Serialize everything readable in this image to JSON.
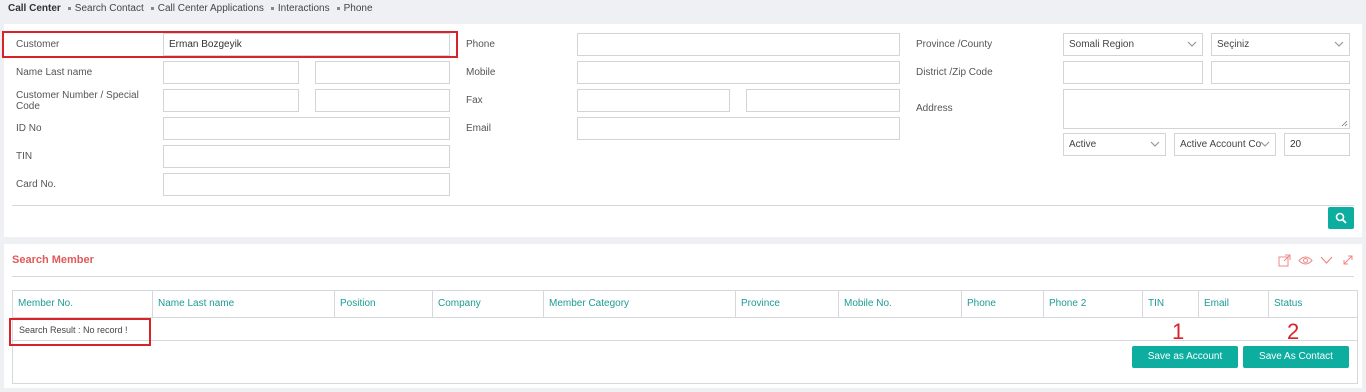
{
  "breadcrumb": {
    "home": "Call Center",
    "items": [
      "Search Contact",
      "Call Center Applications",
      "Interactions",
      "Phone"
    ]
  },
  "form": {
    "customer_label": "Customer",
    "customer_value": "Erman Bozgeyik",
    "name_label": "Name Last name",
    "custnum_label": "Customer Number / Special Code",
    "idno_label": "ID No",
    "tin_label": "TIN",
    "card_label": "Card No.",
    "phone_label": "Phone",
    "mobile_label": "Mobile",
    "fax_label": "Fax",
    "email_label": "Email",
    "province_label": "Province /County",
    "province_value": "Somali Region",
    "county_value": "Seçiniz",
    "district_label": "District /Zip Code",
    "address_label": "Address",
    "status_value": "Active",
    "account_value": "Active Account Co",
    "count_value": "20"
  },
  "search_member": {
    "title": "Search Member",
    "columns": [
      "Member No.",
      "Name Last name",
      "Position",
      "Company",
      "Member Category",
      "Province",
      "Mobile No.",
      "Phone",
      "Phone 2",
      "TIN",
      "Email",
      "Status"
    ],
    "result_text": "Search Result : No record !",
    "save_account_label": "Save as Account",
    "save_contact_label": "Save As Contact",
    "annotation_1": "1",
    "annotation_2": "2"
  },
  "colors": {
    "accent": "#0dada0",
    "title_red": "#e05a5a",
    "highlight_red": "#d9232b",
    "header_teal": "#1b9b96"
  },
  "icons": [
    "search-icon",
    "export-icon",
    "eye-icon",
    "chevron-down-icon",
    "expand-icon"
  ]
}
